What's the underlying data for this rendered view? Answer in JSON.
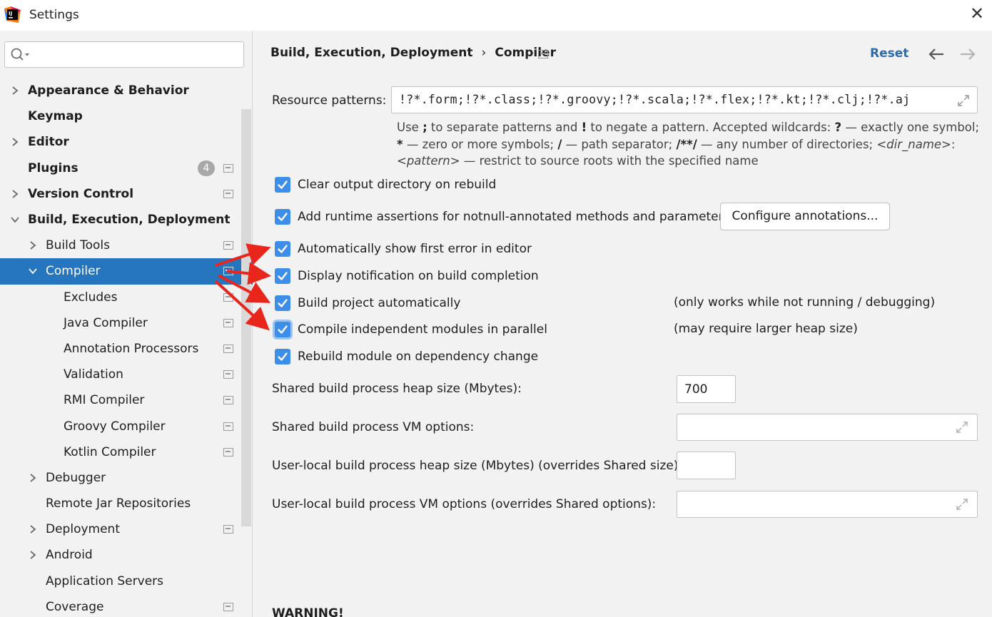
{
  "window": {
    "title": "Settings"
  },
  "search": {
    "placeholder": ""
  },
  "tree": [
    {
      "label": "Appearance & Behavior",
      "bold": true,
      "level": 0,
      "chevron": "right",
      "proj": false
    },
    {
      "label": "Keymap",
      "bold": true,
      "level": 0,
      "chevron": "none",
      "proj": false
    },
    {
      "label": "Editor",
      "bold": true,
      "level": 0,
      "chevron": "right",
      "proj": false
    },
    {
      "label": "Plugins",
      "bold": true,
      "level": 0,
      "chevron": "none",
      "proj": true,
      "badge": "4"
    },
    {
      "label": "Version Control",
      "bold": true,
      "level": 0,
      "chevron": "right",
      "proj": true
    },
    {
      "label": "Build, Execution, Deployment",
      "bold": true,
      "level": 0,
      "chevron": "down",
      "proj": false
    },
    {
      "label": "Build Tools",
      "bold": false,
      "level": 1,
      "chevron": "right",
      "proj": true
    },
    {
      "label": "Compiler",
      "bold": false,
      "level": 1,
      "chevron": "down",
      "proj": true,
      "selected": true
    },
    {
      "label": "Excludes",
      "bold": false,
      "level": 2,
      "chevron": "none",
      "proj": true
    },
    {
      "label": "Java Compiler",
      "bold": false,
      "level": 2,
      "chevron": "none",
      "proj": true
    },
    {
      "label": "Annotation Processors",
      "bold": false,
      "level": 2,
      "chevron": "none",
      "proj": true
    },
    {
      "label": "Validation",
      "bold": false,
      "level": 2,
      "chevron": "none",
      "proj": true
    },
    {
      "label": "RMI Compiler",
      "bold": false,
      "level": 2,
      "chevron": "none",
      "proj": true
    },
    {
      "label": "Groovy Compiler",
      "bold": false,
      "level": 2,
      "chevron": "none",
      "proj": true
    },
    {
      "label": "Kotlin Compiler",
      "bold": false,
      "level": 2,
      "chevron": "none",
      "proj": true
    },
    {
      "label": "Debugger",
      "bold": false,
      "level": 1,
      "chevron": "right",
      "proj": false
    },
    {
      "label": "Remote Jar Repositories",
      "bold": false,
      "level": 1,
      "chevron": "none",
      "proj": false
    },
    {
      "label": "Deployment",
      "bold": false,
      "level": 1,
      "chevron": "right",
      "proj": true
    },
    {
      "label": "Android",
      "bold": false,
      "level": 1,
      "chevron": "right",
      "proj": false
    },
    {
      "label": "Application Servers",
      "bold": false,
      "level": 1,
      "chevron": "none",
      "proj": false
    },
    {
      "label": "Coverage",
      "bold": false,
      "level": 1,
      "chevron": "none",
      "proj": true
    }
  ],
  "header": {
    "crumb_parent": "Build, Execution, Deployment",
    "crumb_sep": "›",
    "crumb_current": "Compiler",
    "reset": "Reset"
  },
  "resource": {
    "label": "Resource patterns:",
    "value": "!?*.form;!?*.class;!?*.groovy;!?*.scala;!?*.flex;!?*.kt;!?*.clj;!?*.aj"
  },
  "help": {
    "p1": "Use ",
    "semicolon": ";",
    "p2": " to separate patterns and ",
    "bang": "!",
    "p3": " to negate a pattern. Accepted wildcards: ",
    "q": "?",
    "p4": " — exactly one symbol; ",
    "star": "*",
    "p5": " — zero or more symbols; ",
    "slash": "/",
    "p6": " — path separator; ",
    "dstar": "/**/",
    "p7": " — any number of directories; ",
    "dirname": "<dir_name>",
    "p8": ": ",
    "pattern": "<pattern>",
    "p9": " — restrict to source roots with the specified name"
  },
  "options": [
    {
      "label": "Clear output directory on rebuild",
      "checked": true
    },
    {
      "label": "Add runtime assertions for notnull-annotated methods and parameters",
      "checked": true
    },
    {
      "label": "Automatically show first error in editor",
      "checked": true
    },
    {
      "label": "Display notification on build completion",
      "checked": true
    },
    {
      "label": "Build project automatically",
      "checked": true,
      "note": "(only works while not running / debugging)"
    },
    {
      "label": "Compile independent modules in parallel",
      "checked": true,
      "focused": true,
      "note": "(may require larger heap size)"
    },
    {
      "label": "Rebuild module on dependency change",
      "checked": true
    }
  ],
  "configure_button": "Configure annotations...",
  "fields": {
    "shared_heap_label": "Shared build process heap size (Mbytes):",
    "shared_heap_value": "700",
    "shared_vm_label": "Shared build process VM options:",
    "shared_vm_value": "",
    "local_heap_label": "User-local build process heap size (Mbytes) (overrides Shared size):",
    "local_heap_value": "",
    "local_vm_label": "User-local build process VM options (overrides Shared options):",
    "local_vm_value": ""
  },
  "warning": "WARNING!",
  "colors": {
    "accent": "#2675bf",
    "checkbox": "#3d8ee8",
    "link": "#2b6cb0",
    "annotation_arrow": "#e8261c"
  }
}
